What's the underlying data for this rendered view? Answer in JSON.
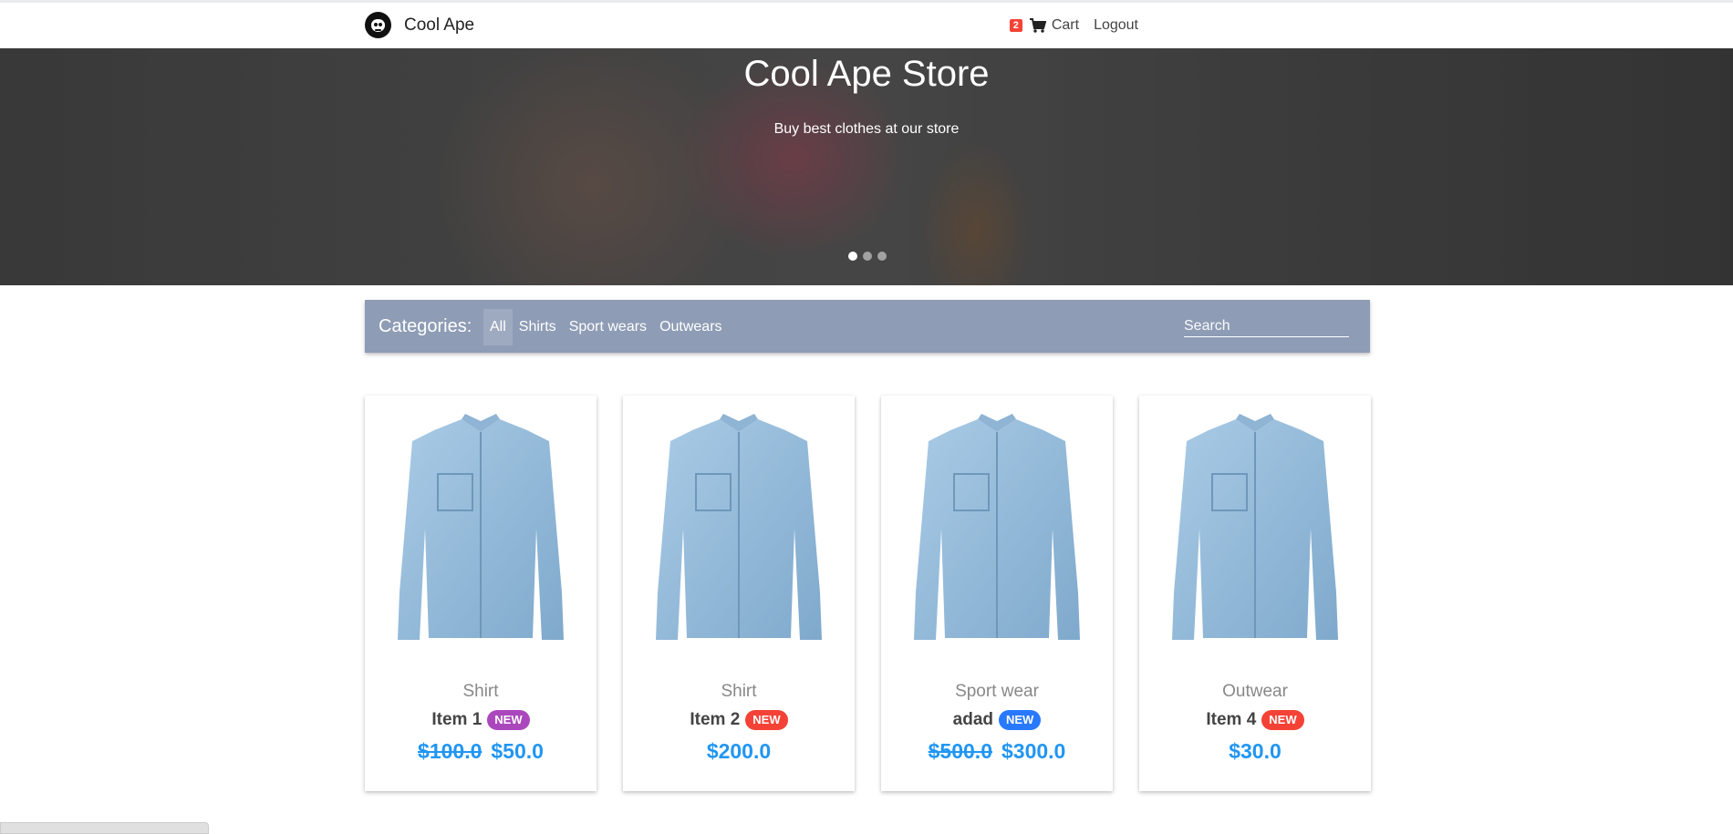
{
  "navbar": {
    "brand": "Cool Ape",
    "cart_count": "2",
    "cart_label": "Cart",
    "logout_label": "Logout"
  },
  "hero": {
    "title": "Cool Ape Store",
    "subtitle": "Buy best clothes at our store",
    "slides": 3,
    "active_slide": 1
  },
  "categories": {
    "label": "Categories:",
    "items": [
      "All",
      "Shirts",
      "Sport wears",
      "Outwears"
    ],
    "active": "All",
    "search_placeholder": "Search"
  },
  "products": [
    {
      "type": "Shirt",
      "name": "Item 1",
      "badge": "NEW",
      "badge_color": "#ab47bc",
      "old_price": "$100.0",
      "price": "$50.0"
    },
    {
      "type": "Shirt",
      "name": "Item 2",
      "badge": "NEW",
      "badge_color": "#f44336",
      "old_price": "",
      "price": "$200.0"
    },
    {
      "type": "Sport wear",
      "name": "adad",
      "badge": "NEW",
      "badge_color": "#2979ff",
      "old_price": "$500.0",
      "price": "$300.0"
    },
    {
      "type": "Outwear",
      "name": "Item 4",
      "badge": "NEW",
      "badge_color": "#f44336",
      "old_price": "",
      "price": "$30.0"
    }
  ],
  "colors": {
    "category_bar": "#8e9cb5",
    "price": "#2196f3",
    "cart_badge": "#f44336"
  },
  "icons": [
    "ape-logo-icon",
    "cart-icon",
    "shirt-image"
  ]
}
